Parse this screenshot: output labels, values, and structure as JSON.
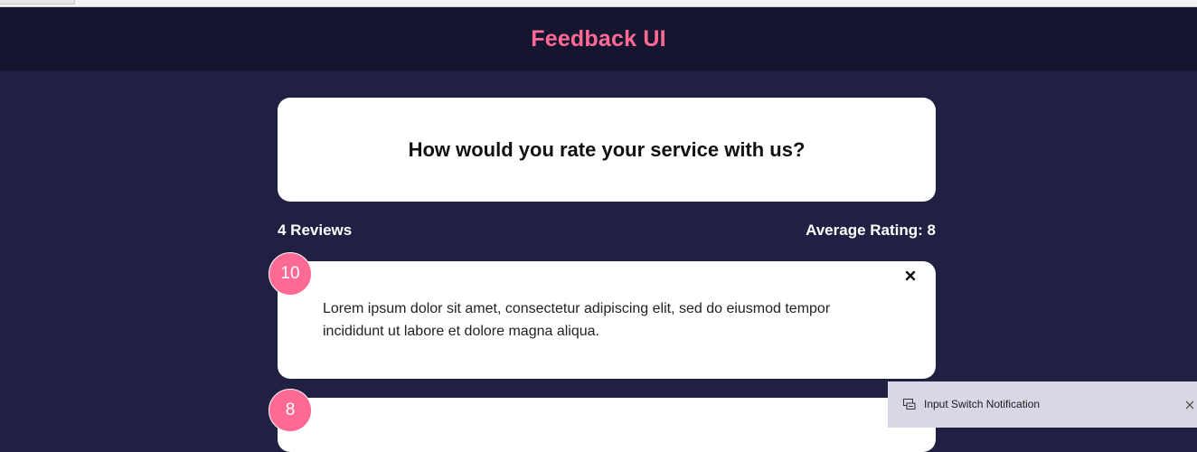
{
  "header": {
    "title": "Feedback UI"
  },
  "question": {
    "text": "How would you rate your service with us?"
  },
  "stats": {
    "reviews_count": "4 Reviews",
    "average_rating": "Average Rating: 8"
  },
  "reviews": [
    {
      "rating": "10",
      "text": "Lorem ipsum dolor sit amet, consectetur adipiscing elit, sed do eiusmod tempor incididunt ut labore et dolore magna aliqua."
    },
    {
      "rating": "8"
    }
  ],
  "notification": {
    "text": "Input Switch Notification"
  },
  "colors": {
    "brand_pink": "#ff6a95",
    "page_bg": "#202142",
    "header_bg": "#151530",
    "card_bg": "#ffffff"
  },
  "icons": {
    "close_review": "close-icon",
    "notification_app": "input-switch-icon",
    "notification_close": "close-icon"
  }
}
